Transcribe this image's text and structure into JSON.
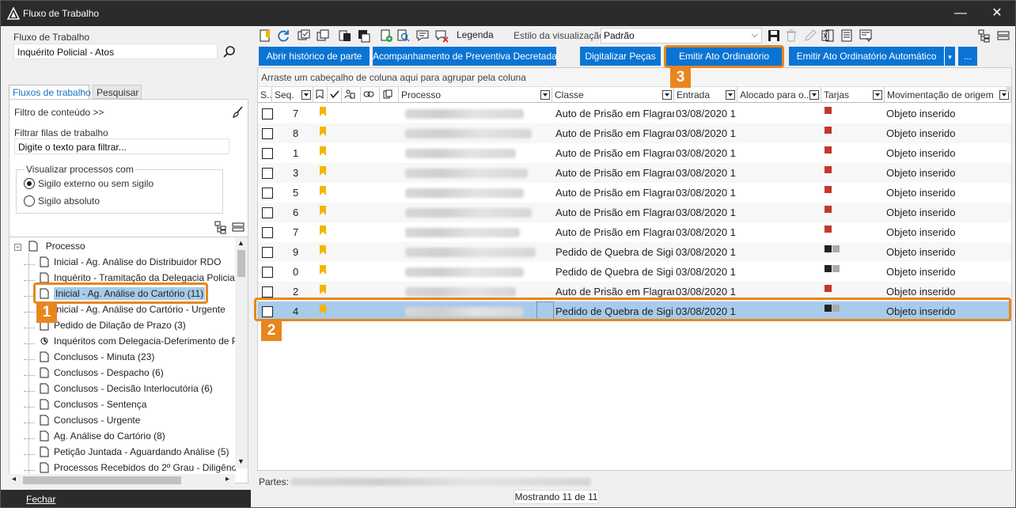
{
  "window": {
    "title": "Fluxo de Trabalho",
    "minimize_label": "—",
    "close_label": "✕"
  },
  "left": {
    "workflow_label": "Fluxo de Trabalho",
    "workflow_value": "Inquérito Policial - Atos",
    "tabs": [
      "Fluxos de trabalho",
      "Pesquisar"
    ],
    "content_filter_label": "Filtro de conteúdo >>",
    "queue_filter_label": "Filtrar filas de trabalho",
    "queue_filter_placeholder": "Digite o texto para filtrar...",
    "view_group_label": "Visualizar processos com",
    "radio_options": [
      "Sigilo externo ou sem sigilo",
      "Sigilo absoluto"
    ],
    "radio_selected": 0,
    "tree_root": "Processo",
    "tree_items": [
      "Inicial - Ag. Análise do Distribuidor RDO",
      "Inquérito - Tramitação da Delegacia Policial",
      "Inicial - Ag. Análise do Cartório (11)",
      "Inicial - Ag. Análise do Cartório - Urgente",
      "Pedido de Dilação de Prazo (3)",
      "Inquéritos com Delegacia-Deferimento de P",
      "Conclusos - Minuta (23)",
      "Conclusos - Despacho (6)",
      "Conclusos - Decisão Interlocutória (6)",
      "Conclusos - Sentença",
      "Conclusos - Urgente",
      "Ag. Análise do Cartório (8)",
      "Petição Juntada - Aguardando Análise (5)",
      "Processos Recebidos do 2º Grau - Diligênc"
    ],
    "close_label": "Fechar"
  },
  "toolbar": {
    "legend_label": "Legenda",
    "view_style_label": "Estilo da visualização",
    "view_style_value": "Padrão"
  },
  "buttons": [
    "Abrir histórico de parte",
    "Acompanhamento de Preventiva Decretada",
    "Digitalizar Peças",
    "Emitir Ato Ordinatório",
    "Emitir Ato Ordinatório Automático",
    "..."
  ],
  "grid": {
    "group_hint": "Arraste um cabeçalho de coluna aqui para agrupar pela coluna",
    "columns": [
      "S...",
      "Seq.",
      "Processo",
      "Classe",
      "Entrada",
      "Alocado para o...",
      "Tarjas",
      "Movimentação de origem"
    ],
    "rows": [
      {
        "seq": "7",
        "classe": "Auto de Prisão em Flagrar",
        "entrada": "03/08/2020 1",
        "tarjas": [
          "#c0392b"
        ],
        "mov": "Objeto inserido"
      },
      {
        "seq": "8",
        "classe": "Auto de Prisão em Flagrar",
        "entrada": "03/08/2020 1",
        "tarjas": [
          "#c0392b"
        ],
        "mov": "Objeto inserido"
      },
      {
        "seq": "1",
        "classe": "Auto de Prisão em Flagrar",
        "entrada": "03/08/2020 1",
        "tarjas": [
          "#c0392b"
        ],
        "mov": "Objeto inserido"
      },
      {
        "seq": "3",
        "classe": "Auto de Prisão em Flagrar",
        "entrada": "03/08/2020 1",
        "tarjas": [
          "#c0392b"
        ],
        "mov": "Objeto inserido"
      },
      {
        "seq": "5",
        "classe": "Auto de Prisão em Flagrar",
        "entrada": "03/08/2020 1",
        "tarjas": [
          "#c0392b"
        ],
        "mov": "Objeto inserido"
      },
      {
        "seq": "6",
        "classe": "Auto de Prisão em Flagrar",
        "entrada": "03/08/2020 1",
        "tarjas": [
          "#c0392b"
        ],
        "mov": "Objeto inserido"
      },
      {
        "seq": "7",
        "classe": "Auto de Prisão em Flagrar",
        "entrada": "03/08/2020 1",
        "tarjas": [
          "#c0392b"
        ],
        "mov": "Objeto inserido"
      },
      {
        "seq": "9",
        "classe": "Pedido de Quebra de Sigi",
        "entrada": "03/08/2020 1",
        "tarjas": [
          "#222222",
          "#aaaaaa"
        ],
        "mov": "Objeto inserido"
      },
      {
        "seq": "0",
        "classe": "Pedido de Quebra de Sigi",
        "entrada": "03/08/2020 1",
        "tarjas": [
          "#222222",
          "#aaaaaa"
        ],
        "mov": "Objeto inserido"
      },
      {
        "seq": "2",
        "classe": "Auto de Prisão em Flagrar",
        "entrada": "03/08/2020 1",
        "tarjas": [
          "#c0392b"
        ],
        "mov": "Objeto inserido"
      },
      {
        "seq": "4",
        "classe": "Pedido de Quebra de Sigi",
        "entrada": "03/08/2020 1",
        "tarjas": [
          "#222222",
          "#aaaaaa"
        ],
        "mov": "Objeto inserido"
      }
    ],
    "selected_row": 10
  },
  "status": {
    "parties_label": "Partes:",
    "count_label": "Mostrando 11 de 11"
  },
  "callouts": [
    "1",
    "2",
    "3"
  ],
  "colors": {
    "accent": "#0a74d4",
    "callout": "#e8861e",
    "selection": "#a7cbe9",
    "flag": "#f5b400"
  }
}
